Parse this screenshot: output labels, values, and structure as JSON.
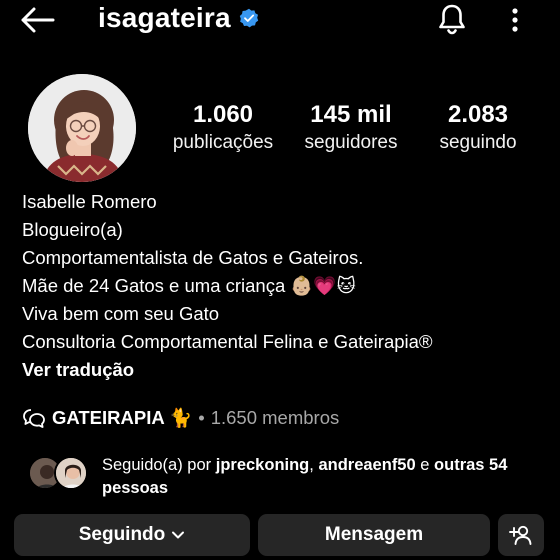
{
  "header": {
    "username": "isagateira",
    "verified": true,
    "icons": {
      "back": "back-arrow-icon",
      "bell": "bell-icon",
      "more": "more-vertical-icon"
    }
  },
  "stats": [
    {
      "value": "1.060",
      "label": "publicações"
    },
    {
      "value": "145 mil",
      "label": "seguidores"
    },
    {
      "value": "2.083",
      "label": "seguindo"
    }
  ],
  "bio": {
    "name": "Isabelle Romero",
    "category": "Blogueiro(a)",
    "lines": [
      "Comportamentalista de Gatos e Gateiros.",
      "Mãe de 24 Gatos e uma criança 👶🏼💗🐱",
      "Viva bem com seu Gato",
      "Consultoria Comportamental Felina e Gateirapia®"
    ],
    "translate": "Ver tradução"
  },
  "community": {
    "name": "GATEIRAPIA 🐈",
    "separator": "•",
    "members": "1.650 membros"
  },
  "followed_by": {
    "prefix": "Seguido(a) por",
    "users": [
      "jpreckoning",
      "andreaenf50"
    ],
    "and": "e",
    "others": "outras 54 pessoas"
  },
  "actions": {
    "following": "Seguindo",
    "message": "Mensagem"
  },
  "colors": {
    "verified": "#3897f0",
    "button_bg": "#262626",
    "muted": "#a8a8a8"
  }
}
